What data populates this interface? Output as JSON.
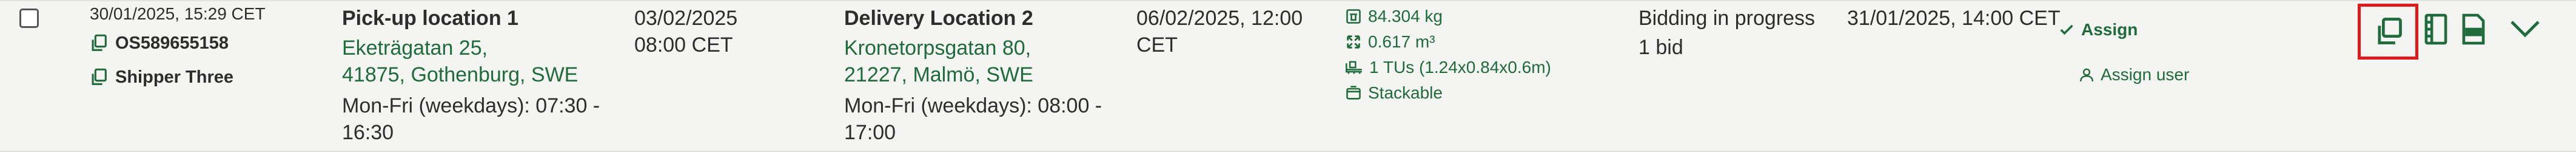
{
  "row": {
    "created": "30/01/2025, 15:29 CET",
    "order_id": "OS589655158",
    "shipper": "Shipper Three",
    "pickup": {
      "title": "Pick-up location 1",
      "address_line1": "Eketrägatan 25,",
      "address_line2": "41875, Gothenburg, SWE",
      "hours_line1": "Mon-Fri (weekdays): 07:30 -",
      "hours_line2": "16:30"
    },
    "pickup_date": {
      "date": "03/02/2025",
      "time": "08:00 CET"
    },
    "delivery": {
      "title": "Delivery Location 2",
      "address_line1": "Kronetorpsgatan 80,",
      "address_line2": "21227, Malmö, SWE",
      "hours_line1": "Mon-Fri (weekdays): 08:00 -",
      "hours_line2": "17:00"
    },
    "delivery_date": {
      "line1": "06/02/2025, 12:00",
      "line2": "CET"
    },
    "cargo": {
      "weight": "84.304 kg",
      "volume": "0.617 m³",
      "tus": "1 TUs (1.24x0.84x0.6m)",
      "stackable": "Stackable"
    },
    "status": {
      "label": "Bidding in progress",
      "bids": "1 bid"
    },
    "deadline": "31/01/2025, 14:00 CET",
    "actions": {
      "assign": "Assign",
      "assign_user": "Assign user"
    }
  },
  "icons": {
    "copy": "copy-icon",
    "document": "document-icon",
    "pdf": "pdf-icon",
    "expand": "chevron-down-icon"
  },
  "colors": {
    "background": "#f4f4f2",
    "accent_green": "#1f6b3c",
    "highlight": "#e01a1a"
  }
}
